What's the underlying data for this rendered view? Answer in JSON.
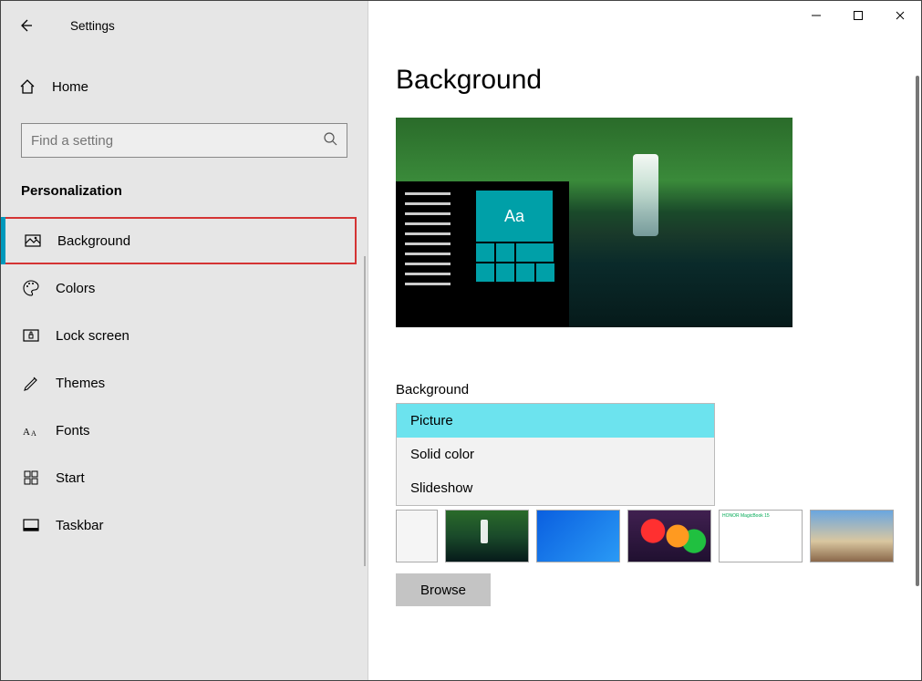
{
  "app_title": "Settings",
  "home_label": "Home",
  "search": {
    "placeholder": "Find a setting"
  },
  "category": "Personalization",
  "sidebar": {
    "items": [
      {
        "label": "Background",
        "selected": true
      },
      {
        "label": "Colors"
      },
      {
        "label": "Lock screen"
      },
      {
        "label": "Themes"
      },
      {
        "label": "Fonts"
      },
      {
        "label": "Start"
      },
      {
        "label": "Taskbar"
      }
    ]
  },
  "page": {
    "title": "Background",
    "preview_tile_text": "Aa",
    "bg_field_label": "Background",
    "dropdown": {
      "options": [
        "Picture",
        "Solid color",
        "Slideshow"
      ],
      "selected": "Picture"
    },
    "browse_label": "Browse"
  }
}
